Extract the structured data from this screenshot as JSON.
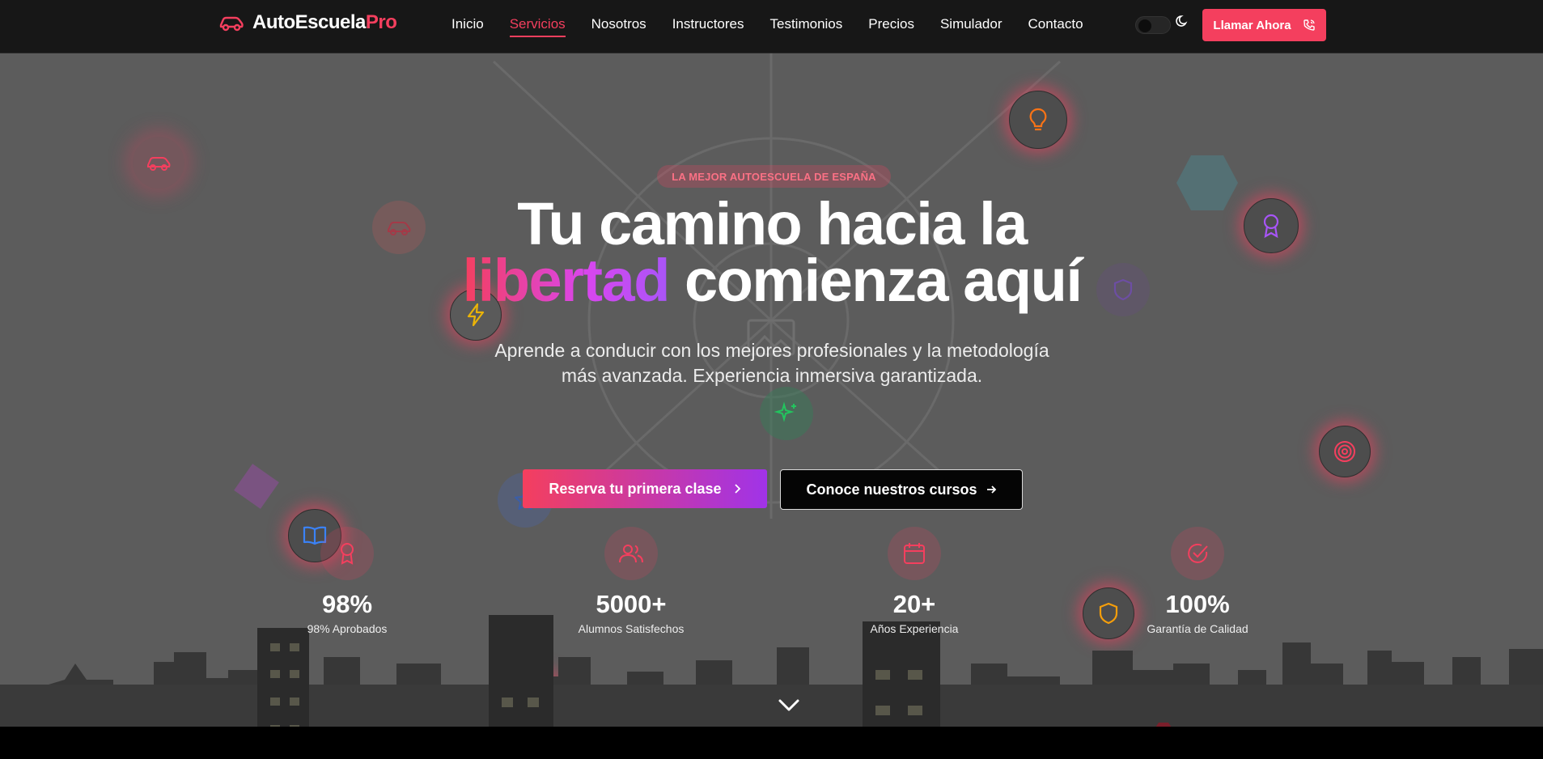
{
  "brand": {
    "name_main": "AutoEscuela",
    "name_accent": "Pro"
  },
  "nav": {
    "items": [
      {
        "label": "Inicio",
        "active": false
      },
      {
        "label": "Servicios",
        "active": true
      },
      {
        "label": "Nosotros",
        "active": false
      },
      {
        "label": "Instructores",
        "active": false
      },
      {
        "label": "Testimonios",
        "active": false
      },
      {
        "label": "Precios",
        "active": false
      },
      {
        "label": "Simulador",
        "active": false
      },
      {
        "label": "Contacto",
        "active": false
      }
    ],
    "call_label": "Llamar Ahora"
  },
  "hero": {
    "badge": "LA MEJOR AUTOESCUELA DE ESPAÑA",
    "title_line1": "Tu camino hacia la",
    "title_highlight": "libertad",
    "title_line2_rest": " comienza aquí",
    "subtitle_line1": "Aprende a conducir con los mejores profesionales y la metodología",
    "subtitle_line2": "más avanzada. Experiencia inmersiva garantizada.",
    "cta_primary": "Reserva tu primera clase",
    "cta_secondary": "Conoce nuestros cursos"
  },
  "stats": [
    {
      "value": "98%",
      "label": "98% Aprobados",
      "icon": "award-icon"
    },
    {
      "value": "5000+",
      "label": "Alumnos Satisfechos",
      "icon": "users-icon"
    },
    {
      "value": "20+",
      "label": "Años Experiencia",
      "icon": "calendar-icon"
    },
    {
      "value": "100%",
      "label": "Garantía de Calidad",
      "icon": "check-circle-icon"
    }
  ],
  "colors": {
    "accent": "#f43f5e",
    "gradient_end": "#a855f7",
    "navbar_bg": "#171717",
    "hero_bg": "#5c5c5c"
  }
}
